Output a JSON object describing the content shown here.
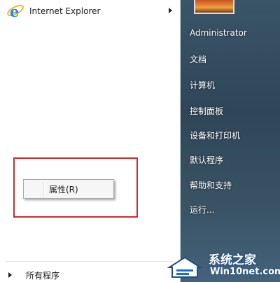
{
  "left_pane": {
    "pinned": {
      "label": "Internet Explorer",
      "icon": "internet-explorer-icon"
    },
    "context_menu": {
      "item_label": "属性(R)"
    },
    "all_programs": {
      "label": "所有程序"
    }
  },
  "right_pane": {
    "items": [
      "Administrator",
      "文档",
      "计算机",
      "控制面板",
      "设备和打印机",
      "默认程序",
      "帮助和支持",
      "运行..."
    ]
  },
  "watermark": {
    "title": "系统之家",
    "url": "Win10net.com"
  },
  "colors": {
    "highlight": "#cf2b2b",
    "right_pane": "#2f4a5e"
  }
}
